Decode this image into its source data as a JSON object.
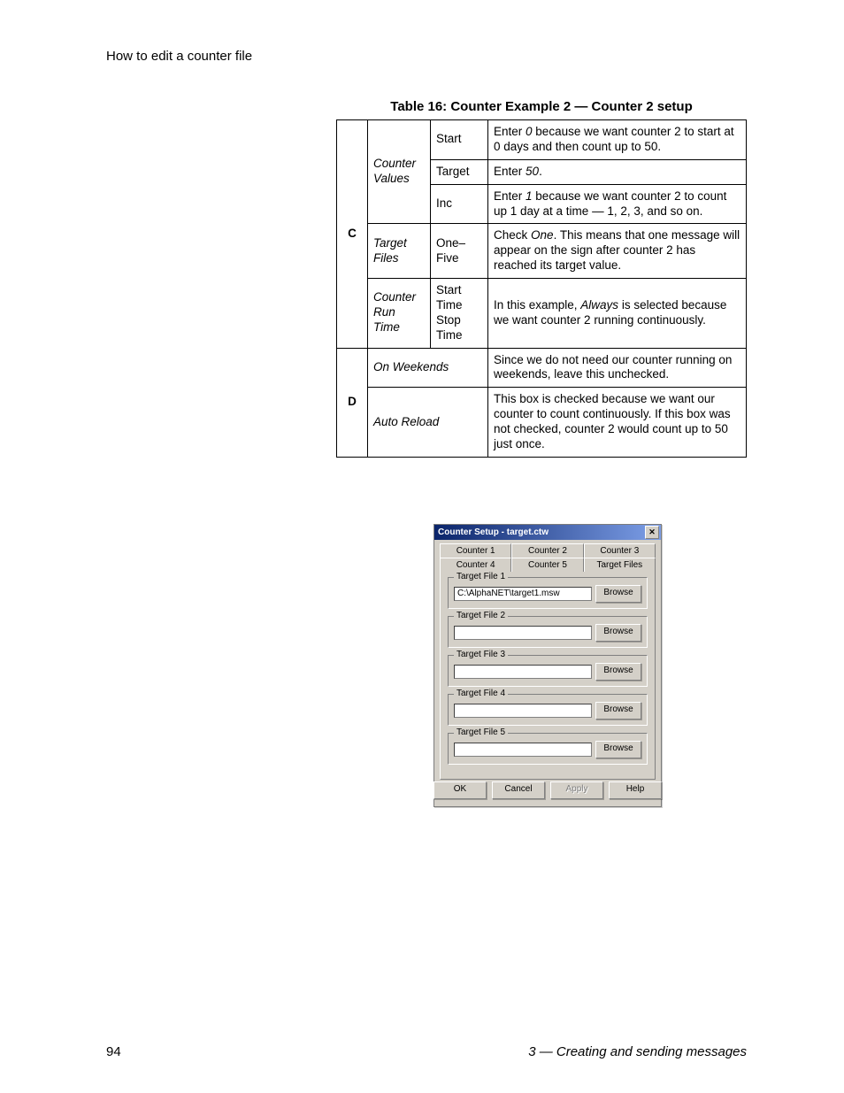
{
  "header": {
    "section_title": "How to edit a counter file"
  },
  "table": {
    "caption": "Table 16: Counter Example 2 — Counter 2 setup",
    "rowC": {
      "letter": "C",
      "counter_values_label": "Counter Values",
      "start_label": "Start",
      "start_desc_pre": "Enter ",
      "start_desc_val": "0",
      "start_desc_post": " because we want counter 2 to start at 0 days and then count up to 50.",
      "target_label": "Target",
      "target_desc_pre": "Enter ",
      "target_desc_val": "50",
      "target_desc_post": ".",
      "inc_label": "Inc",
      "inc_desc_pre": "Enter ",
      "inc_desc_val": "1",
      "inc_desc_post": " because we want counter 2 to count up 1 day at a time — 1, 2, 3, and so on.",
      "target_files_label": "Target Files",
      "target_files_col": "One–Five",
      "target_files_desc_pre": "Check ",
      "target_files_desc_val": "One",
      "target_files_desc_post": ". This means that one message will appear on the sign after counter 2 has reached its target value.",
      "crt_label": "Counter Run Time",
      "crt_col": "Start Time Stop Time",
      "crt_desc_pre": "In this example, ",
      "crt_desc_val": "Always",
      "crt_desc_post": " is selected because we want counter 2 running continuously."
    },
    "rowD": {
      "letter": "D",
      "weekends_label": "On Weekends",
      "weekends_desc": "Since we do not need our counter running on weekends, leave this unchecked.",
      "auto_reload_label": "Auto Reload",
      "auto_reload_desc": "This box is checked because we want our counter to count continuously. If this box was not checked, counter 2 would count up to 50 just once."
    }
  },
  "dialog": {
    "title": "Counter Setup - target.ctw",
    "tabs": {
      "c1": "Counter 1",
      "c2": "Counter 2",
      "c3": "Counter 3",
      "c4": "Counter 4",
      "c5": "Counter 5",
      "tf": "Target Files"
    },
    "groups": {
      "tf1": "Target File 1",
      "tf2": "Target File 2",
      "tf3": "Target File 3",
      "tf4": "Target File 4",
      "tf5": "Target File 5"
    },
    "values": {
      "tf1": "C:\\AlphaNET\\target1.msw",
      "tf2": "",
      "tf3": "",
      "tf4": "",
      "tf5": ""
    },
    "browse": "Browse",
    "buttons": {
      "ok": "OK",
      "cancel": "Cancel",
      "apply": "Apply",
      "help": "Help"
    }
  },
  "footer": {
    "page": "94",
    "chapter": "3 — Creating and sending messages"
  }
}
